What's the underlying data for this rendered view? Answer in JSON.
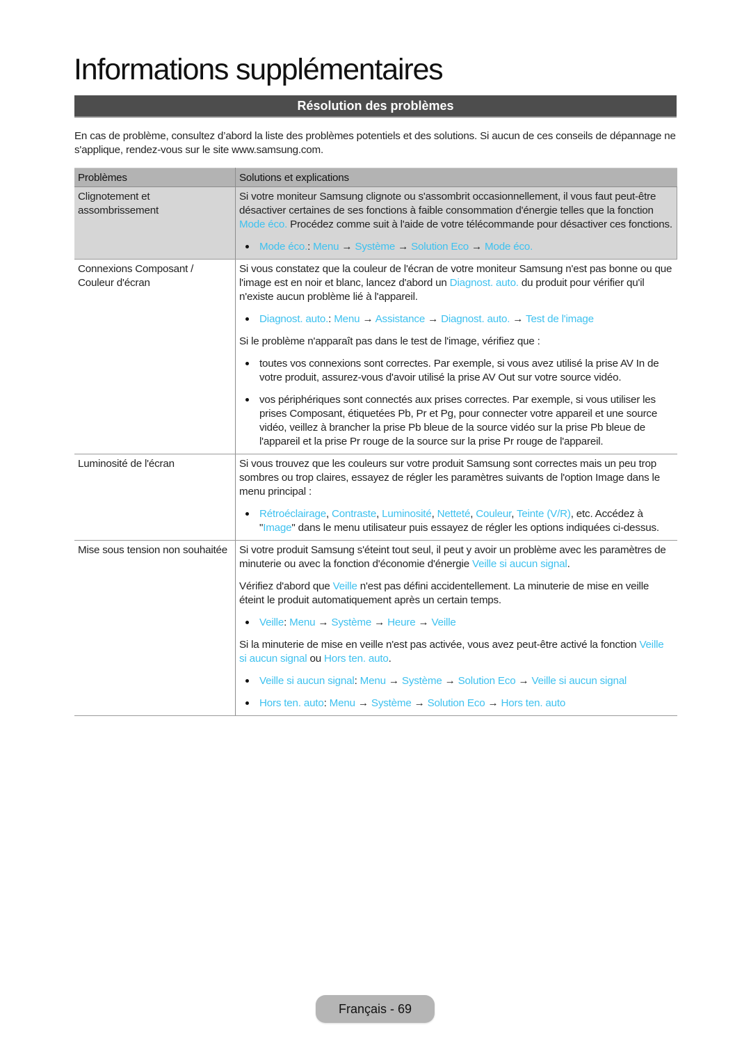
{
  "page_title": "Informations supplémentaires",
  "section_title": "Résolution des problèmes",
  "intro": "En cas de problème, consultez d’abord la liste des problèmes potentiels et des solutions. Si aucun de ces conseils de dépannage ne s'applique, rendez-vous sur le site www.samsung.com.",
  "colors": {
    "link": "#3ec1ef",
    "section_bar": "#4d4d4d",
    "header_row": "#b3b3b3",
    "shaded_row": "#d6d6d6"
  },
  "table": {
    "headers": [
      "Problèmes",
      "Solutions et explications"
    ],
    "rows": [
      {
        "problem": "Clignotement et assombrissement",
        "shaded": true,
        "blocks": [
          {
            "type": "para",
            "segments": [
              {
                "t": "Si votre moniteur Samsung clignote ou s'assombrit occasionnellement, il vous faut peut-être désactiver certaines de ses fonctions à faible consommation d'énergie telles que la fonction "
              },
              {
                "t": "Mode éco.",
                "link": true
              },
              {
                "t": " Procédez comme suit à l'aide de votre télécommande pour désactiver ces fonctions."
              }
            ]
          },
          {
            "type": "bullet",
            "segments": [
              {
                "t": "Mode éco.",
                "link": true
              },
              {
                "t": ": "
              },
              {
                "t": "Menu",
                "link": true
              },
              {
                "t": " → "
              },
              {
                "t": "Système",
                "link": true
              },
              {
                "t": " → "
              },
              {
                "t": "Solution Eco",
                "link": true
              },
              {
                "t": " → "
              },
              {
                "t": "Mode éco.",
                "link": true
              }
            ]
          }
        ]
      },
      {
        "problem": "Connexions Composant / Couleur d'écran",
        "shaded": false,
        "blocks": [
          {
            "type": "para",
            "segments": [
              {
                "t": "Si vous constatez que la couleur de l'écran de votre moniteur Samsung n'est pas bonne ou que l'image est en noir et blanc, lancez d'abord un "
              },
              {
                "t": "Diagnost. auto.",
                "link": true
              },
              {
                "t": " du produit pour vérifier qu'il n'existe aucun problème lié à l'appareil."
              }
            ]
          },
          {
            "type": "bullet",
            "segments": [
              {
                "t": "Diagnost. auto.",
                "link": true
              },
              {
                "t": ": "
              },
              {
                "t": "Menu",
                "link": true
              },
              {
                "t": " → "
              },
              {
                "t": "Assistance",
                "link": true
              },
              {
                "t": " → "
              },
              {
                "t": "Diagnost. auto.",
                "link": true
              },
              {
                "t": " → "
              },
              {
                "t": "Test de l'image",
                "link": true
              }
            ]
          },
          {
            "type": "para",
            "segments": [
              {
                "t": "Si le problème n'apparaît pas dans le test de l'image, vérifiez que :"
              }
            ]
          },
          {
            "type": "bullet",
            "segments": [
              {
                "t": "toutes vos connexions sont correctes. Par exemple, si vous avez utilisé la prise AV In de votre produit, assurez-vous d'avoir utilisé la prise AV Out sur votre source vidéo."
              }
            ]
          },
          {
            "type": "bullet",
            "segments": [
              {
                "t": "vos périphériques sont connectés aux prises correctes. Par exemple, si vous utiliser les prises Composant, étiquetées Pb, Pr et Pg, pour connecter votre appareil et une source vidéo, veillez à brancher la prise Pb bleue de la source vidéo sur la prise Pb bleue de l'appareil et la prise Pr rouge de la source sur la prise Pr rouge de l'appareil."
              }
            ]
          }
        ]
      },
      {
        "problem": "Luminosité de l'écran",
        "shaded": false,
        "blocks": [
          {
            "type": "para",
            "segments": [
              {
                "t": "Si vous trouvez que les couleurs sur votre produit Samsung sont correctes mais un peu trop sombres ou trop claires, essayez de régler les paramètres suivants de l'option Image dans le menu principal :"
              }
            ]
          },
          {
            "type": "bullet",
            "segments": [
              {
                "t": "Rétroéclairage",
                "link": true
              },
              {
                "t": ", "
              },
              {
                "t": "Contraste",
                "link": true
              },
              {
                "t": ", "
              },
              {
                "t": "Luminosité",
                "link": true
              },
              {
                "t": ", "
              },
              {
                "t": "Netteté",
                "link": true
              },
              {
                "t": ", "
              },
              {
                "t": "Couleur",
                "link": true
              },
              {
                "t": ", "
              },
              {
                "t": "Teinte (V/R)",
                "link": true
              },
              {
                "t": ", etc. Accédez à \""
              },
              {
                "t": "Image",
                "link": true
              },
              {
                "t": "\" dans le menu utilisateur puis essayez de régler les options indiquées ci-dessus."
              }
            ]
          }
        ]
      },
      {
        "problem": "Mise sous tension non souhaitée",
        "shaded": false,
        "blocks": [
          {
            "type": "para",
            "segments": [
              {
                "t": "Si votre produit Samsung s'éteint tout seul, il peut y avoir un problème avec les paramètres de minuterie ou avec la fonction d'économie d'énergie "
              },
              {
                "t": "Veille si aucun signal",
                "link": true
              },
              {
                "t": "."
              }
            ]
          },
          {
            "type": "para",
            "segments": [
              {
                "t": "Vérifiez d'abord que "
              },
              {
                "t": "Veille",
                "link": true
              },
              {
                "t": " n'est pas défini accidentellement. La minuterie de mise en veille éteint le produit automatiquement après un certain temps."
              }
            ]
          },
          {
            "type": "bullet",
            "segments": [
              {
                "t": "Veille",
                "link": true
              },
              {
                "t": ": "
              },
              {
                "t": "Menu",
                "link": true
              },
              {
                "t": " → "
              },
              {
                "t": "Système",
                "link": true
              },
              {
                "t": " → "
              },
              {
                "t": "Heure",
                "link": true
              },
              {
                "t": " → "
              },
              {
                "t": "Veille",
                "link": true
              }
            ]
          },
          {
            "type": "para",
            "segments": [
              {
                "t": "Si la minuterie de mise en veille n'est pas activée, vous avez peut-être activé la fonction "
              },
              {
                "t": "Veille si aucun signal",
                "link": true
              },
              {
                "t": " ou "
              },
              {
                "t": "Hors ten. auto",
                "link": true
              },
              {
                "t": "."
              }
            ]
          },
          {
            "type": "bullet",
            "segments": [
              {
                "t": "Veille si aucun signal",
                "link": true
              },
              {
                "t": ": "
              },
              {
                "t": "Menu",
                "link": true
              },
              {
                "t": " → "
              },
              {
                "t": "Système",
                "link": true
              },
              {
                "t": " → "
              },
              {
                "t": "Solution Eco",
                "link": true
              },
              {
                "t": " → "
              },
              {
                "t": "Veille si aucun signal",
                "link": true
              }
            ]
          },
          {
            "type": "bullet",
            "segments": [
              {
                "t": "Hors ten. auto",
                "link": true
              },
              {
                "t": ": "
              },
              {
                "t": "Menu",
                "link": true
              },
              {
                "t": " → "
              },
              {
                "t": "Système",
                "link": true
              },
              {
                "t": " → "
              },
              {
                "t": "Solution Eco",
                "link": true
              },
              {
                "t": " → "
              },
              {
                "t": "Hors ten. auto",
                "link": true
              }
            ]
          }
        ]
      }
    ]
  },
  "footer": {
    "language": "Français",
    "separator": "-",
    "page_number": "69",
    "label": "Français - 69"
  }
}
